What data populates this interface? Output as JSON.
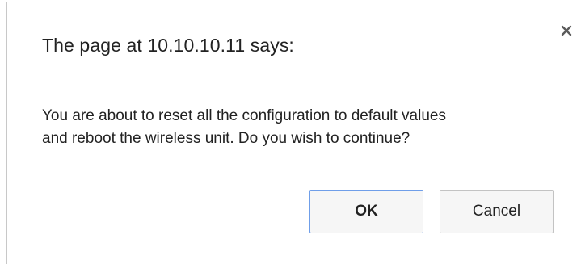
{
  "dialog": {
    "title": "The page at 10.10.10.11 says:",
    "message_line1": "You are about to reset all the configuration to default values",
    "message_line2": "and reboot the wireless unit. Do you wish to continue?",
    "close_icon": "close-icon",
    "ok_label": "OK",
    "cancel_label": "Cancel"
  },
  "colors": {
    "ok_border": "#6f9ee9",
    "text": "#222222",
    "button_bg": "#f6f6f6"
  }
}
